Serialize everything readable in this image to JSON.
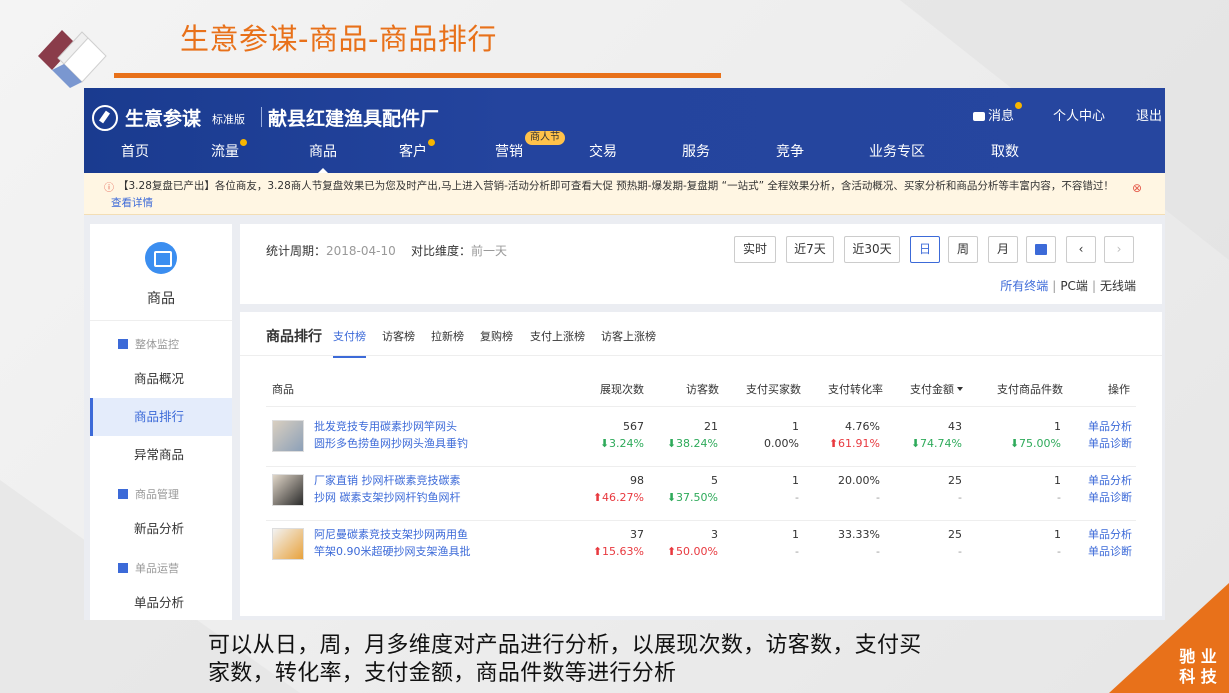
{
  "slide": {
    "title": "生意参谋-商品-商品排行",
    "caption_line1": "可以从日，周，月多维度对产品进行分析，以展现次数，访客数，支付买",
    "caption_line2": "家数，转化率，支付金额，商品件数等进行分析",
    "corner_line1": "驰 业",
    "corner_line2": "科 技",
    "accent_color": "#e8711a"
  },
  "app": {
    "brand": "生意参谋",
    "version": "标准版",
    "shop": "献县红建渔具配件厂",
    "top_links": {
      "messages": "消息",
      "profile": "个人中心",
      "logout": "退出"
    },
    "nav": [
      "首页",
      "流量",
      "商品",
      "客户",
      "营销",
      "交易",
      "服务",
      "竞争",
      "业务专区",
      "取数"
    ],
    "nav_active": "商品",
    "nav_badge": "商人节",
    "notice": {
      "text": "【3.28复盘已产出】各位商友，3.28商人节复盘效果已为您及时产出,马上进入营销-活动分析即可查看大促 预热期-爆发期-复盘期 “一站式” 全程效果分析，含活动概况、买家分析和商品分析等丰富内容，不容错过！",
      "link": "查看详情"
    },
    "sidebar": {
      "title": "商品",
      "groups": {
        "monitor": "整体监控",
        "manage": "商品管理",
        "single": "单品运营"
      },
      "items": {
        "overview": "商品概况",
        "ranking": "商品排行",
        "abnormal": "异常商品",
        "new_analysis": "新品分析",
        "single_analysis": "单品分析"
      }
    },
    "period": {
      "label": "统计周期：",
      "date": "2018-04-10",
      "compare_label": "对比维度：",
      "compare_value": "前一天",
      "buttons": [
        "实时",
        "近7天",
        "近30天",
        "日",
        "周",
        "月"
      ],
      "active_button": "日",
      "prev": "‹",
      "next": "›",
      "terminals": [
        "所有终端",
        "PC端",
        "无线端"
      ],
      "terminal_sep": "|"
    },
    "ranking": {
      "heading": "商品排行",
      "tabs": [
        "支付榜",
        "访客榜",
        "拉新榜",
        "复购榜",
        "支付上涨榜",
        "访客上涨榜"
      ],
      "headers": [
        "商品",
        "展现次数",
        "访客数",
        "支付买家数",
        "支付转化率",
        "支付金额",
        "支付商品件数",
        "操作"
      ],
      "rows": [
        {
          "name1": "批发竞技专用碳素抄网竿网头",
          "name2": "圆形多色捞鱼网抄网头渔具垂钓",
          "impressions": "567",
          "impressions_chg": "3.24%",
          "visitors": "21",
          "visitors_chg": "38.24%",
          "buyers": "1",
          "buyers_chg": "0.00%",
          "conversion": "4.76%",
          "conversion_chg": "61.91%",
          "amount": "43",
          "amount_chg": "74.74%",
          "items": "1",
          "items_chg": "75.00%",
          "op1": "单品分析",
          "op2": "单品诊断"
        },
        {
          "name1": "厂家直销 抄网杆碳素竞技碳素",
          "name2": "抄网 碳素支架抄网杆钓鱼网杆",
          "impressions": "98",
          "impressions_chg": "46.27%",
          "visitors": "5",
          "visitors_chg": "37.50%",
          "buyers": "1",
          "buyers_chg": "-",
          "conversion": "20.00%",
          "conversion_chg": "-",
          "amount": "25",
          "amount_chg": "-",
          "items": "1",
          "items_chg": "-",
          "op1": "单品分析",
          "op2": "单品诊断"
        },
        {
          "name1": "阿尼曼碳素竞技支架抄网两用鱼",
          "name2": "竿架0.90米超硬抄网支架渔具批",
          "impressions": "37",
          "impressions_chg": "15.63%",
          "visitors": "3",
          "visitors_chg": "50.00%",
          "buyers": "1",
          "buyers_chg": "-",
          "conversion": "33.33%",
          "conversion_chg": "-",
          "amount": "25",
          "amount_chg": "-",
          "items": "1",
          "items_chg": "-",
          "op1": "单品分析",
          "op2": "单品诊断"
        }
      ]
    }
  }
}
